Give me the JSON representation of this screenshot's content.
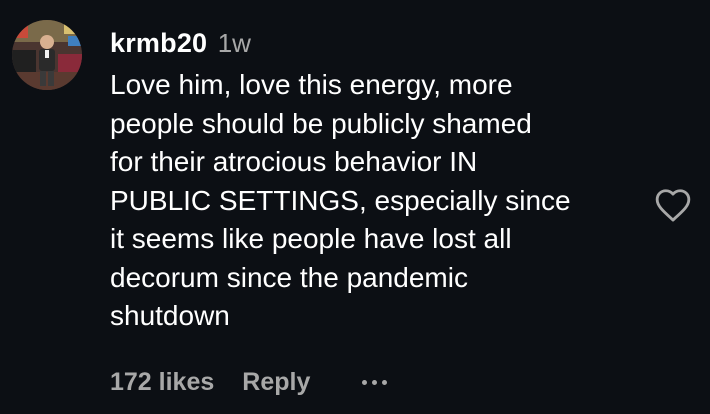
{
  "comment": {
    "username": "krmb20",
    "time_ago": "1w",
    "text_lines": [
      "Love him, love this energy, more",
      "people should be publicly shamed",
      "for their atrocious behavior IN",
      "PUBLIC SETTINGS, especially since",
      "it seems like people have lost all",
      "decorum since the pandemic",
      "shutdown"
    ],
    "likes_label": "172 likes",
    "reply_label": "Reply",
    "like_icon": "heart-outline-icon",
    "more_icon": "ellipsis-icon"
  },
  "colors": {
    "background": "#0c0f14",
    "primary_text": "#ffffff",
    "secondary_text": "#a8a8a8"
  }
}
